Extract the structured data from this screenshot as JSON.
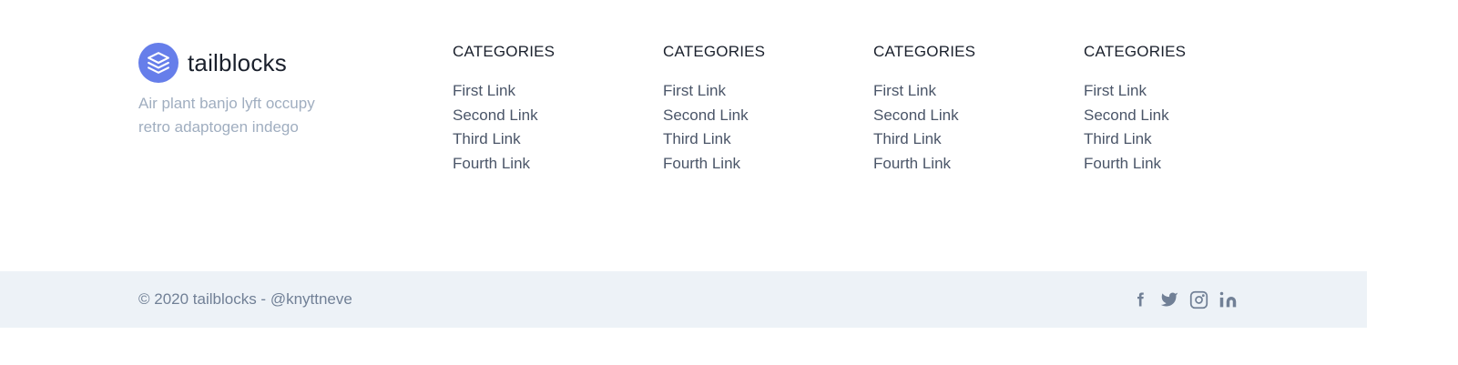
{
  "brand": {
    "name": "tailblocks",
    "description": "Air plant banjo lyft occupy retro adaptogen indego",
    "logo_color": "#667eea"
  },
  "columns": [
    {
      "title": "CATEGORIES",
      "links": [
        "First Link",
        "Second Link",
        "Third Link",
        "Fourth Link"
      ]
    },
    {
      "title": "CATEGORIES",
      "links": [
        "First Link",
        "Second Link",
        "Third Link",
        "Fourth Link"
      ]
    },
    {
      "title": "CATEGORIES",
      "links": [
        "First Link",
        "Second Link",
        "Third Link",
        "Fourth Link"
      ]
    },
    {
      "title": "CATEGORIES",
      "links": [
        "First Link",
        "Second Link",
        "Third Link",
        "Fourth Link"
      ]
    }
  ],
  "bottom": {
    "copyright": "© 2020 tailblocks - @knyttneve",
    "background": "#edf2f7",
    "social_icons": [
      "facebook-icon",
      "twitter-icon",
      "instagram-icon",
      "linkedin-icon"
    ]
  }
}
